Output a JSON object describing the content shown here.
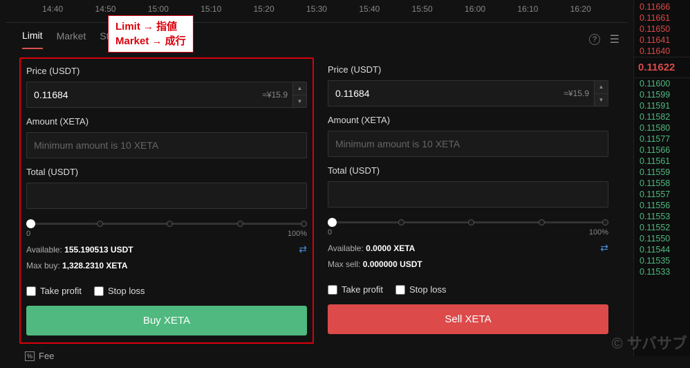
{
  "timeAxis": [
    "14:40",
    "14:50",
    "15:00",
    "15:10",
    "15:20",
    "15:30",
    "15:40",
    "15:50",
    "16:00",
    "16:10",
    "16:20"
  ],
  "tabs": {
    "limit": "Limit",
    "market": "Market",
    "stop": "St"
  },
  "annotation": {
    "line1": "Limit → 指値",
    "line2": "Market → 成行"
  },
  "buy": {
    "priceLabel": "Price (USDT)",
    "priceValue": "0.11684",
    "priceApprox": "≈¥15.9",
    "amountLabel": "Amount (XETA)",
    "amountPlaceholder": "Minimum amount is 10 XETA",
    "totalLabel": "Total (USDT)",
    "sliderMin": "0",
    "sliderMax": "100%",
    "availableLabel": "Available:",
    "availableValue": "155.190513 USDT",
    "maxLabel": "Max buy:",
    "maxValue": "1,328.2310 XETA",
    "takeProfit": "Take profit",
    "stopLoss": "Stop loss",
    "button": "Buy XETA"
  },
  "sell": {
    "priceLabel": "Price (USDT)",
    "priceValue": "0.11684",
    "priceApprox": "≈¥15.9",
    "amountLabel": "Amount (XETA)",
    "amountPlaceholder": "Minimum amount is 10 XETA",
    "totalLabel": "Total (USDT)",
    "sliderMin": "0",
    "sliderMax": "100%",
    "availableLabel": "Available:",
    "availableValue": "0.0000 XETA",
    "maxLabel": "Max sell:",
    "maxValue": "0.000000 USDT",
    "takeProfit": "Take profit",
    "stopLoss": "Stop loss",
    "button": "Sell XETA"
  },
  "fee": "Fee",
  "orderbook": {
    "asks": [
      "0.11666",
      "0.11661",
      "0.11650",
      "0.11641",
      "0.11640"
    ],
    "current": "0.11622",
    "bids": [
      "0.11600",
      "0.11599",
      "0.11591",
      "0.11582",
      "0.11580",
      "0.11577",
      "0.11566",
      "0.11561",
      "0.11559",
      "0.11558",
      "0.11557",
      "0.11556",
      "0.11553",
      "0.11552",
      "0.11550",
      "0.11544",
      "0.11535",
      "0.11533"
    ]
  },
  "watermark": "© サバサブ"
}
